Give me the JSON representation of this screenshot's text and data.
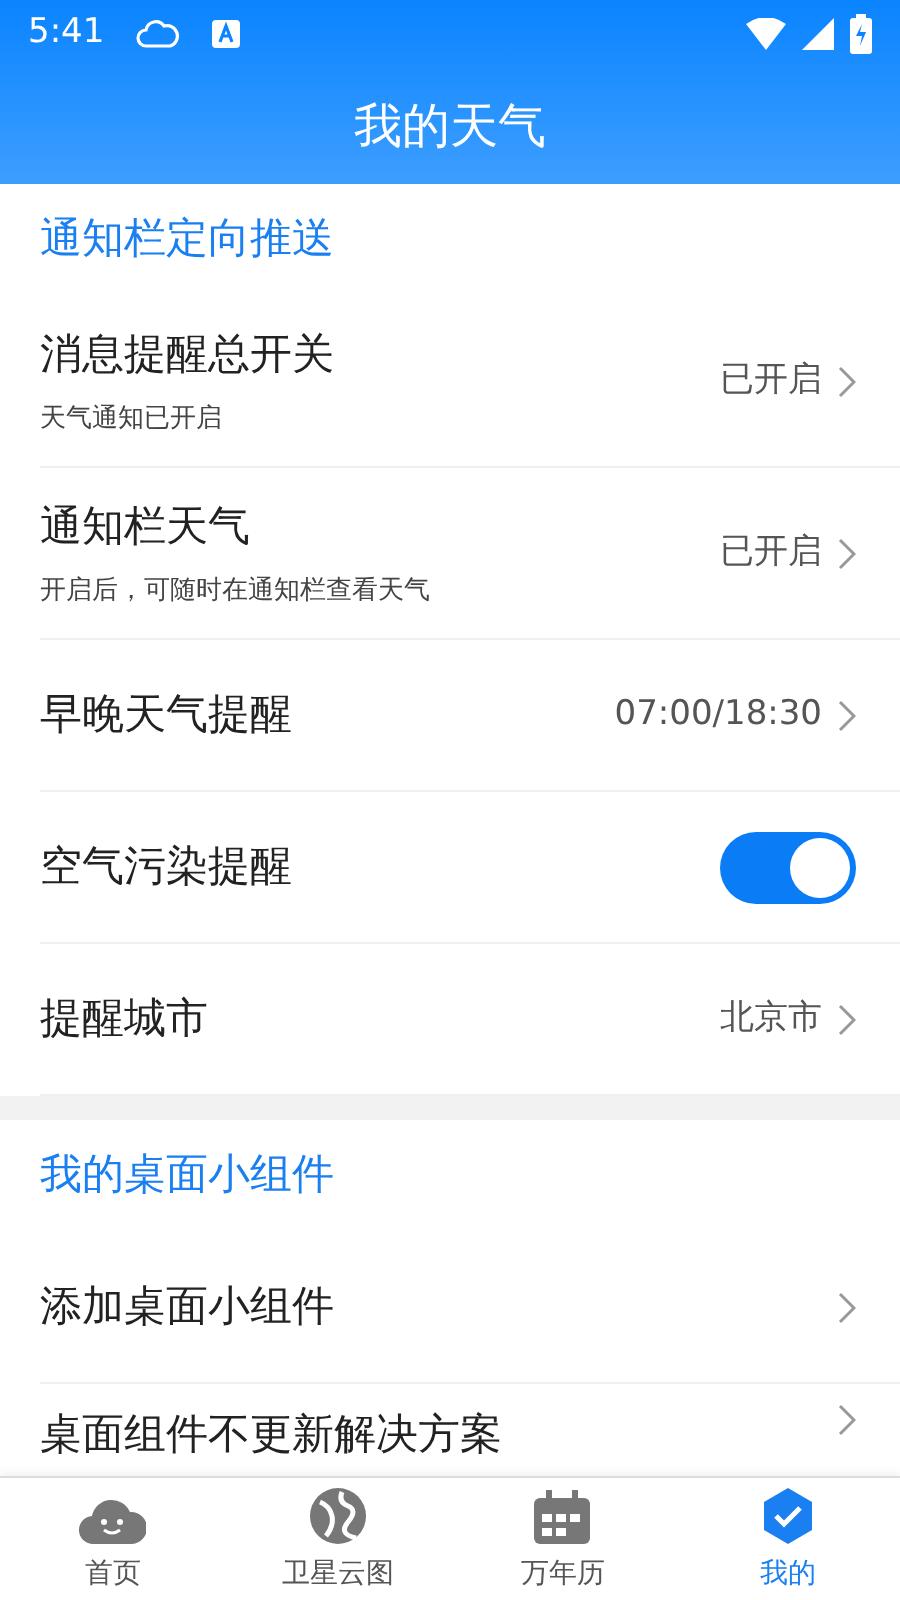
{
  "status_bar": {
    "time": "5:41"
  },
  "header": {
    "title": "我的天气"
  },
  "sections": [
    {
      "title": "通知栏定向推送",
      "rows": [
        {
          "kind": "link",
          "label": "消息提醒总开关",
          "subtitle": "天气通知已开启",
          "value": "已开启"
        },
        {
          "kind": "link",
          "label": "通知栏天气",
          "subtitle": "开启后，可随时在通知栏查看天气",
          "value": "已开启"
        },
        {
          "kind": "link",
          "label": "早晚天气提醒",
          "value": "07:00/18:30"
        },
        {
          "kind": "toggle",
          "label": "空气污染提醒",
          "on": true
        },
        {
          "kind": "link",
          "label": "提醒城市",
          "value": "北京市"
        }
      ]
    },
    {
      "title": "我的桌面小组件",
      "rows": [
        {
          "kind": "link",
          "label": "添加桌面小组件"
        },
        {
          "kind": "link",
          "label": "桌面组件不更新解决方案"
        }
      ]
    }
  ],
  "tab_bar": [
    {
      "label": "首页",
      "kind": "cloud",
      "selected": false
    },
    {
      "label": "卫星云图",
      "kind": "globe",
      "selected": false
    },
    {
      "label": "万年历",
      "kind": "calendar",
      "selected": false
    },
    {
      "label": "我的",
      "kind": "person",
      "selected": true
    }
  ]
}
